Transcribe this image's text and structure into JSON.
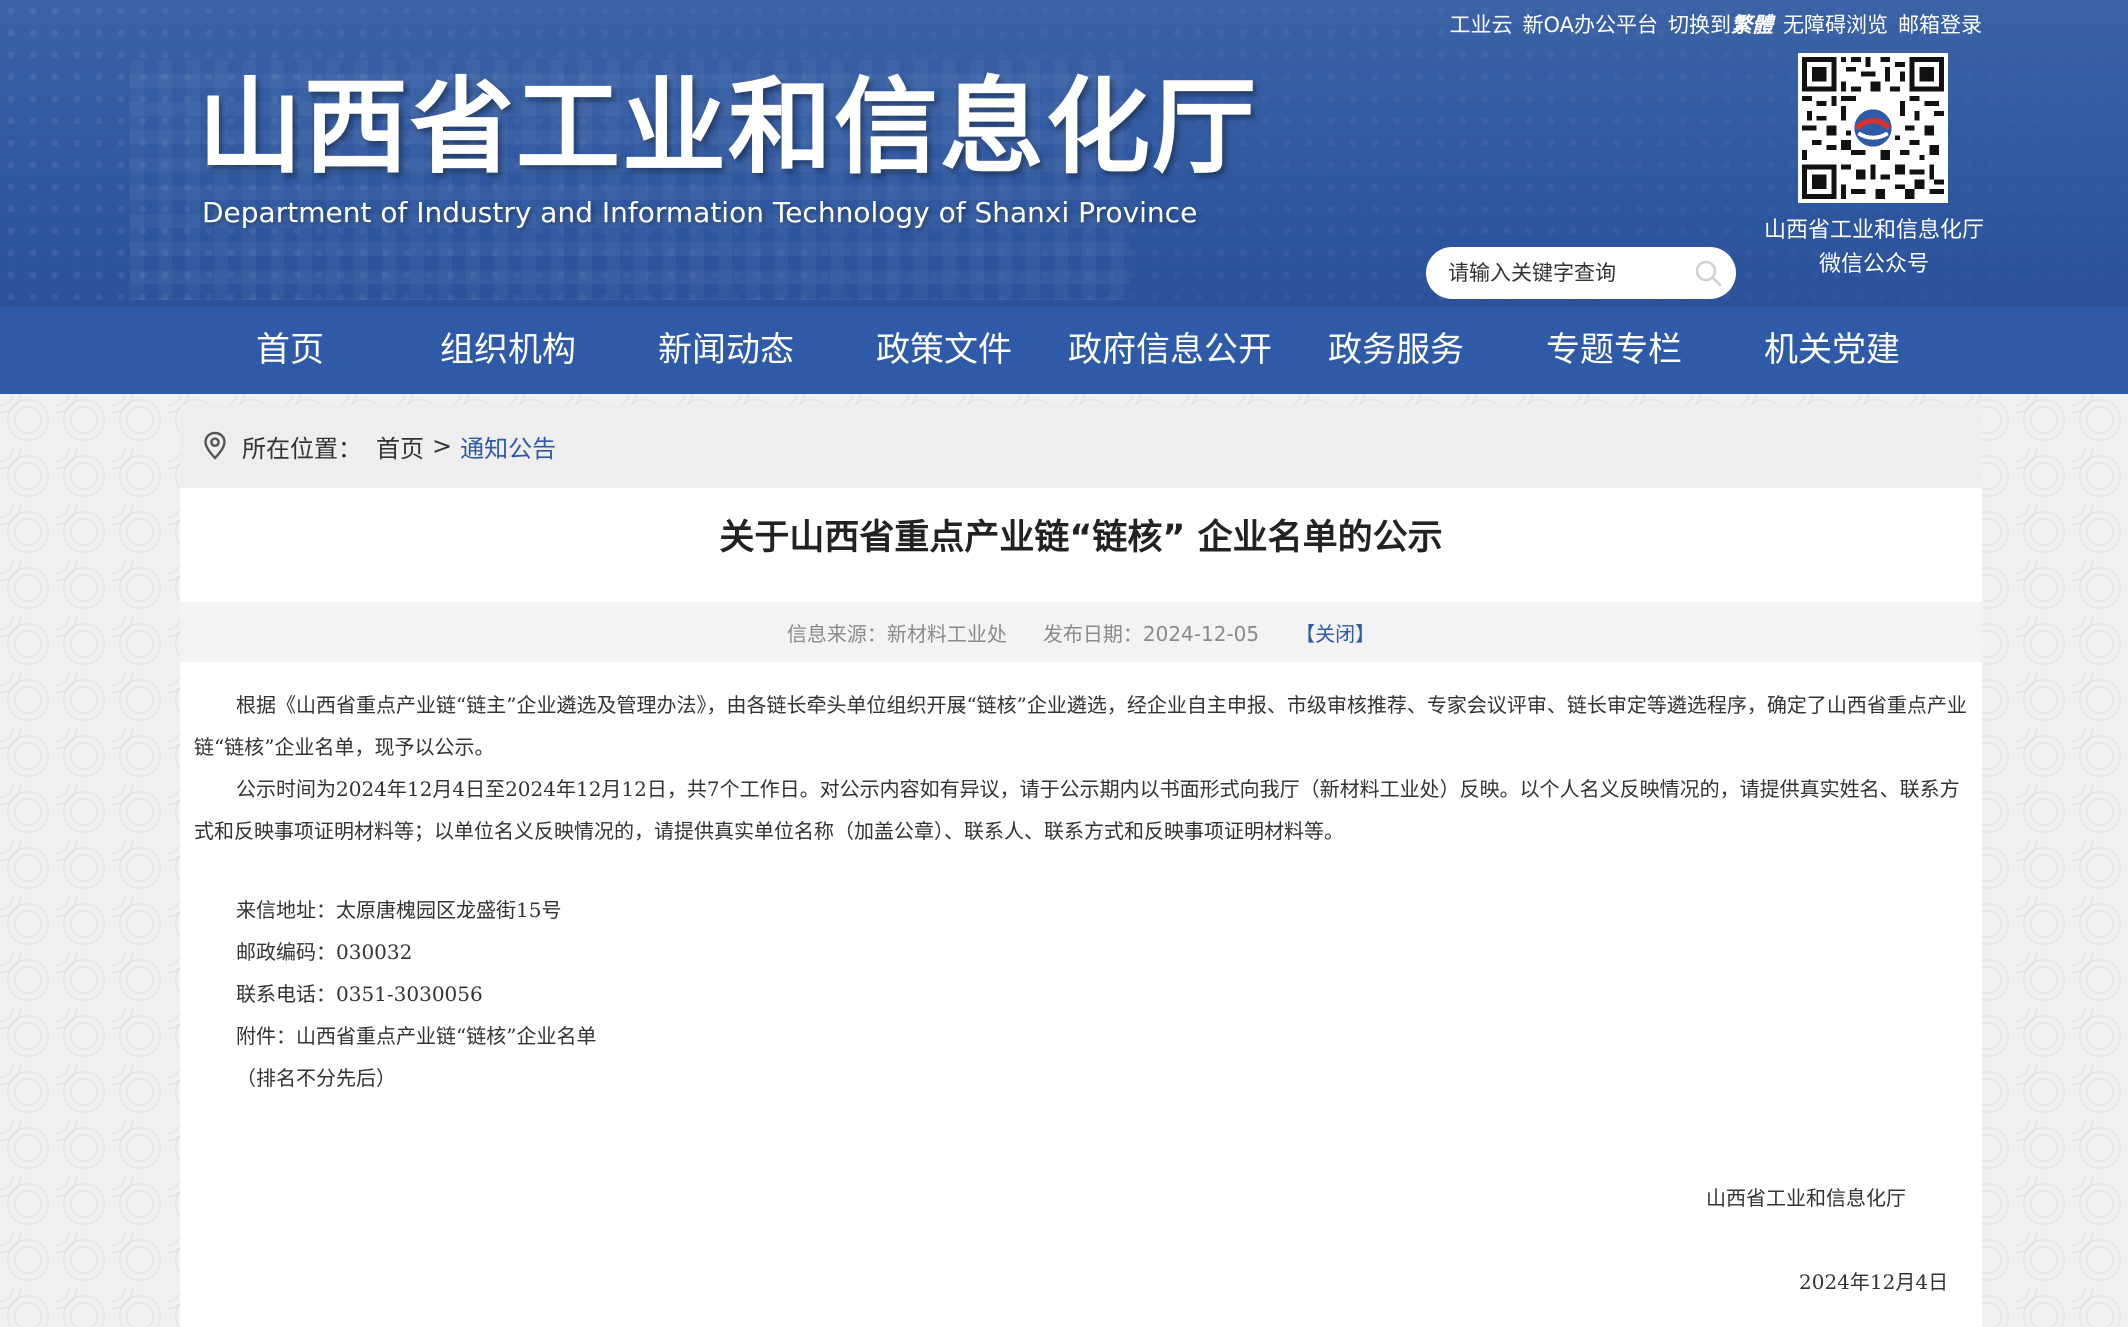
{
  "header": {
    "top_links": [
      "工业云",
      "新OA办公平台",
      "切换到",
      "繁體",
      "无障碍浏览",
      "邮箱登录"
    ],
    "site_title": "山西省工业和信息化厅",
    "site_subtitle": "Department of Industry and Information Technology of Shanxi Province",
    "search_placeholder": "请输入关键字查询",
    "qr_caption_line1": "山西省工业和信息化厅",
    "qr_caption_line2": "微信公众号"
  },
  "nav": {
    "items": [
      "首页",
      "组织机构",
      "新闻动态",
      "政策文件",
      "政府信息公开",
      "政务服务",
      "专题专栏",
      "机关党建"
    ]
  },
  "breadcrumb": {
    "label": "所在位置：",
    "home": "首页",
    "separator": ">",
    "current": "通知公告"
  },
  "article": {
    "title": "关于山西省重点产业链“链核” 企业名单的公示",
    "source": "信息来源：新材料工业处",
    "date": "发布日期：2024-12-05",
    "close_label": "【关闭】",
    "paragraphs": [
      "根据《山西省重点产业链“链主”企业遴选及管理办法》，由各链长牵头单位组织开展“链核”企业遴选，经企业自主申报、市级审核推荐、专家会议评审、链长审定等遴选程序，确定了山西省重点产业链“链核”企业名单，现予以公示。",
      "公示时间为2024年12月4日至2024年12月12日，共7个工作日。对公示内容如有异议，请于公示期内以书面形式向我厅（新材料工业处）反映。以个人名义反映情况的，请提供真实姓名、联系方式和反映事项证明材料等；以单位名义反映情况的，请提供真实单位名称（加盖公章）、联系人、联系方式和反映事项证明材料等。"
    ],
    "contact": {
      "address": "来信地址：太原唐槐园区龙盛街15号",
      "postcode": "邮政编码：030032",
      "phone": "联系电话：0351-3030056",
      "attachment": "附件：山西省重点产业链“链核”企业名单",
      "note": "（排名不分先后）"
    },
    "signature": "山西省工业和信息化厅",
    "sign_date": "2024年12月4日"
  }
}
